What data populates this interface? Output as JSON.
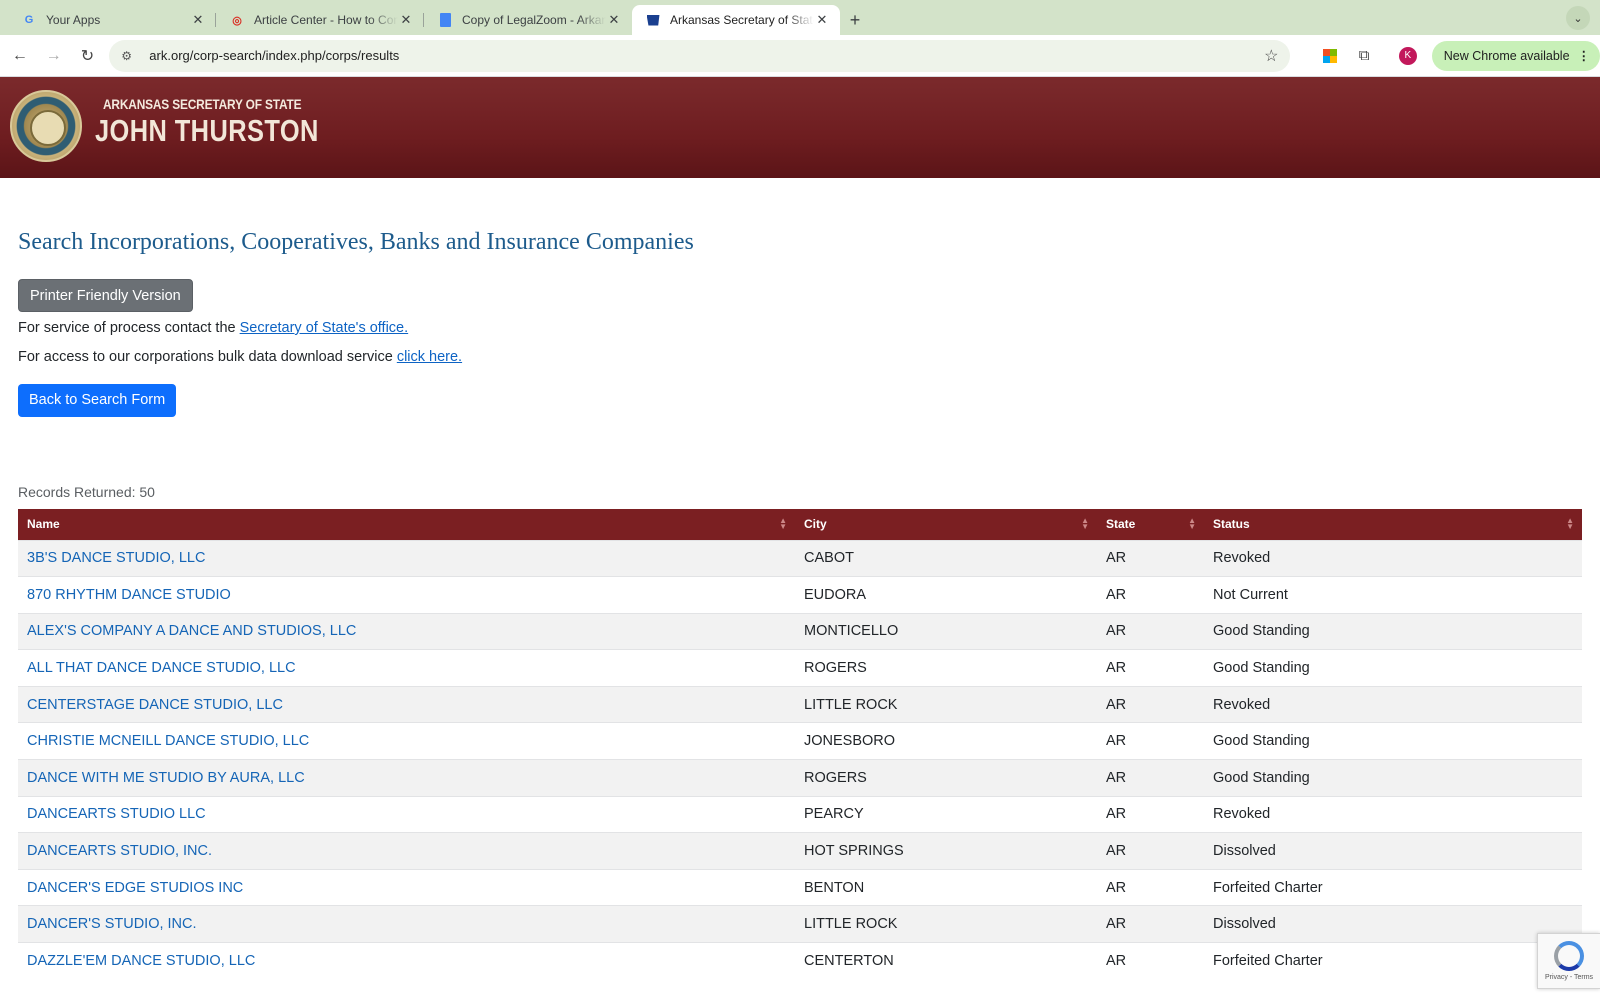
{
  "browser": {
    "tabs": [
      {
        "title": "Your Apps",
        "favicon": "google-g-icon"
      },
      {
        "title": "Article Center - How to Conduct",
        "favicon": "article-center-icon"
      },
      {
        "title": "Copy of LegalZoom - Arkansas",
        "favicon": "google-docs-icon"
      },
      {
        "title": "Arkansas Secretary of State",
        "favicon": "arkansas-state-icon"
      }
    ],
    "active_tab": 3,
    "url": "ark.org/corp-search/index.php/corps/results",
    "profile_initial": "K",
    "update_label": "New Chrome available"
  },
  "site": {
    "office": "ARKANSAS SECRETARY OF STATE",
    "official": "JOHN THURSTON",
    "header_color": "#7b2a2c"
  },
  "page": {
    "title": "Search Incorporations, Cooperatives, Banks and Insurance Companies",
    "printer_button": "Printer Friendly Version",
    "service_text": "For service of process contact the ",
    "service_link": "Secretary of State's office.",
    "bulk_text": "For access to our corporations bulk data download service ",
    "bulk_link": "click here.",
    "back_button": "Back to Search Form",
    "records_label": "Records Returned: 50"
  },
  "table": {
    "headers": [
      "Name",
      "City",
      "State",
      "Status"
    ],
    "rows": [
      {
        "name": "3B'S DANCE STUDIO, LLC",
        "city": "CABOT",
        "state": "AR",
        "status": "Revoked"
      },
      {
        "name": "870 RHYTHM DANCE STUDIO",
        "city": "EUDORA",
        "state": "AR",
        "status": "Not Current"
      },
      {
        "name": "ALEX'S COMPANY A DANCE AND STUDIOS, LLC",
        "city": "MONTICELLO",
        "state": "AR",
        "status": "Good Standing"
      },
      {
        "name": "ALL THAT DANCE DANCE STUDIO, LLC",
        "city": "ROGERS",
        "state": "AR",
        "status": "Good Standing"
      },
      {
        "name": "CENTERSTAGE DANCE STUDIO, LLC",
        "city": "LITTLE ROCK",
        "state": "AR",
        "status": "Revoked"
      },
      {
        "name": "CHRISTIE MCNEILL DANCE STUDIO, LLC",
        "city": "JONESBORO",
        "state": "AR",
        "status": "Good Standing"
      },
      {
        "name": "DANCE WITH ME STUDIO BY AURA, LLC",
        "city": "ROGERS",
        "state": "AR",
        "status": "Good Standing"
      },
      {
        "name": "DANCEARTS STUDIO LLC",
        "city": "PEARCY",
        "state": "AR",
        "status": "Revoked"
      },
      {
        "name": "DANCEARTS STUDIO, INC.",
        "city": "HOT SPRINGS",
        "state": "AR",
        "status": "Dissolved"
      },
      {
        "name": "DANCER'S EDGE STUDIOS INC",
        "city": "BENTON",
        "state": "AR",
        "status": "Forfeited Charter"
      },
      {
        "name": "DANCER'S STUDIO, INC.",
        "city": "LITTLE ROCK",
        "state": "AR",
        "status": "Dissolved"
      },
      {
        "name": "DAZZLE'EM DANCE STUDIO, LLC",
        "city": "CENTERTON",
        "state": "AR",
        "status": "Forfeited Charter"
      }
    ]
  },
  "recaptcha": {
    "terms": "Privacy - Terms"
  }
}
